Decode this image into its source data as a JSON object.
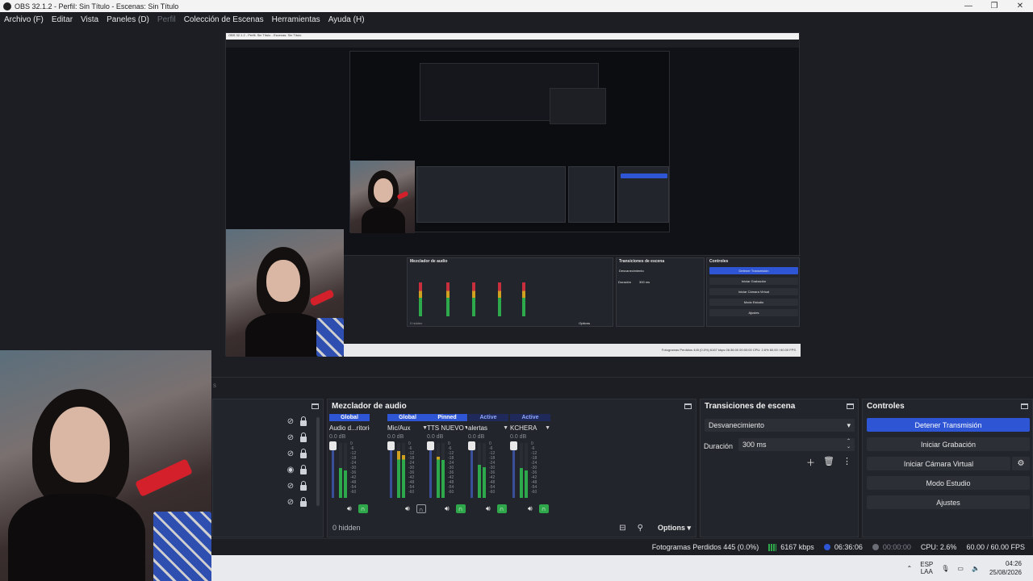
{
  "window": {
    "title": "OBS 32.1.2 - Perfil: Sin Título - Escenas: Sin Título",
    "controls": [
      "—",
      "❐",
      "✕"
    ]
  },
  "menu": [
    {
      "label": "Archivo (F)",
      "disabled": false
    },
    {
      "label": "Editar",
      "disabled": false
    },
    {
      "label": "Vista",
      "disabled": false
    },
    {
      "label": "Paneles (D)",
      "disabled": false
    },
    {
      "label": "Perfil",
      "disabled": true
    },
    {
      "label": "Colección de Escenas",
      "disabled": false
    },
    {
      "label": "Herramientas",
      "disabled": false
    },
    {
      "label": "Ayuda (H)",
      "disabled": false
    }
  ],
  "dock_strip": {
    "label": "s"
  },
  "mixer": {
    "title": "Mezclador de audio",
    "channels": [
      {
        "badge": "Global",
        "badge_active": false,
        "name": "Audio d...ritorio",
        "db": "0.0 dB",
        "level": 0.55,
        "headphone_on": true
      },
      {
        "badge": "Global",
        "badge_active": false,
        "name": "Mic/Aux",
        "db": "0.0 dB",
        "level": 0.85,
        "headphone_on": false
      },
      {
        "badge": "Pinned",
        "badge_active": false,
        "name": "TTS NUEVO",
        "db": "0.0 dB",
        "level": 0.75,
        "headphone_on": true
      },
      {
        "badge": "Active",
        "badge_active": true,
        "name": "alertas",
        "db": "0.0 dB",
        "level": 0.6,
        "headphone_on": true
      },
      {
        "badge": "Active",
        "badge_active": true,
        "name": "KCHERA",
        "db": "0.0 dB",
        "level": 0.55,
        "headphone_on": true
      }
    ],
    "scale": [
      "0",
      "-6",
      "-12",
      "-18",
      "-24",
      "-30",
      "-36",
      "-42",
      "-48",
      "-54",
      "-60"
    ],
    "hidden_label": "0 hidden",
    "options_label": "Options"
  },
  "transitions": {
    "title": "Transiciones de escena",
    "selected": "Desvanecimiento",
    "duration_label": "Duración",
    "duration_value": "300 ms"
  },
  "controls": {
    "title": "Controles",
    "stop_stream": "Detener Transmisión",
    "start_recording": "Iniciar Grabación",
    "start_virtual_cam": "Iniciar Cámara Virtual",
    "studio_mode": "Modo Estudio",
    "settings": "Ajustes"
  },
  "status": {
    "dropped_frames": "Fotogramas Perdidos 445 (0.0%)",
    "bitrate": "6167 kbps",
    "stream_time": "06:36:06",
    "rec_time": "00:00:00",
    "cpu": "CPU: 2.6%",
    "fps": "60.00 / 60.00 FPS"
  },
  "taskbar": {
    "lang_top": "ESP",
    "lang_bottom": "LAA",
    "time": "04:26",
    "date": "25/08/2026"
  },
  "nested": {
    "title": "OBS 32.1.2 - Perfil: Sin Título - Escenas: Sin Título",
    "mixer_title": "Mezclador de audio",
    "transitions_title": "Transiciones de escena",
    "controls_title": "Controles",
    "stop_stream": "Detener Transmisión",
    "start_recording": "Iniciar Grabación",
    "start_virtual_cam": "Iniciar Cámara Virtual",
    "studio_mode": "Modo Estudio",
    "settings": "Ajustes",
    "transition": "Desvanecimiento",
    "duration_label": "Duración",
    "duration_value": "300 ms",
    "hidden_label": "0 hidden",
    "options_label": "Options",
    "status_text": "Fotogramas Perdidos 445 (0.0%)    6167 kbps    06:36:00    00:00:00    CPU: 2.6%    60.00 / 60.00 FPS"
  }
}
